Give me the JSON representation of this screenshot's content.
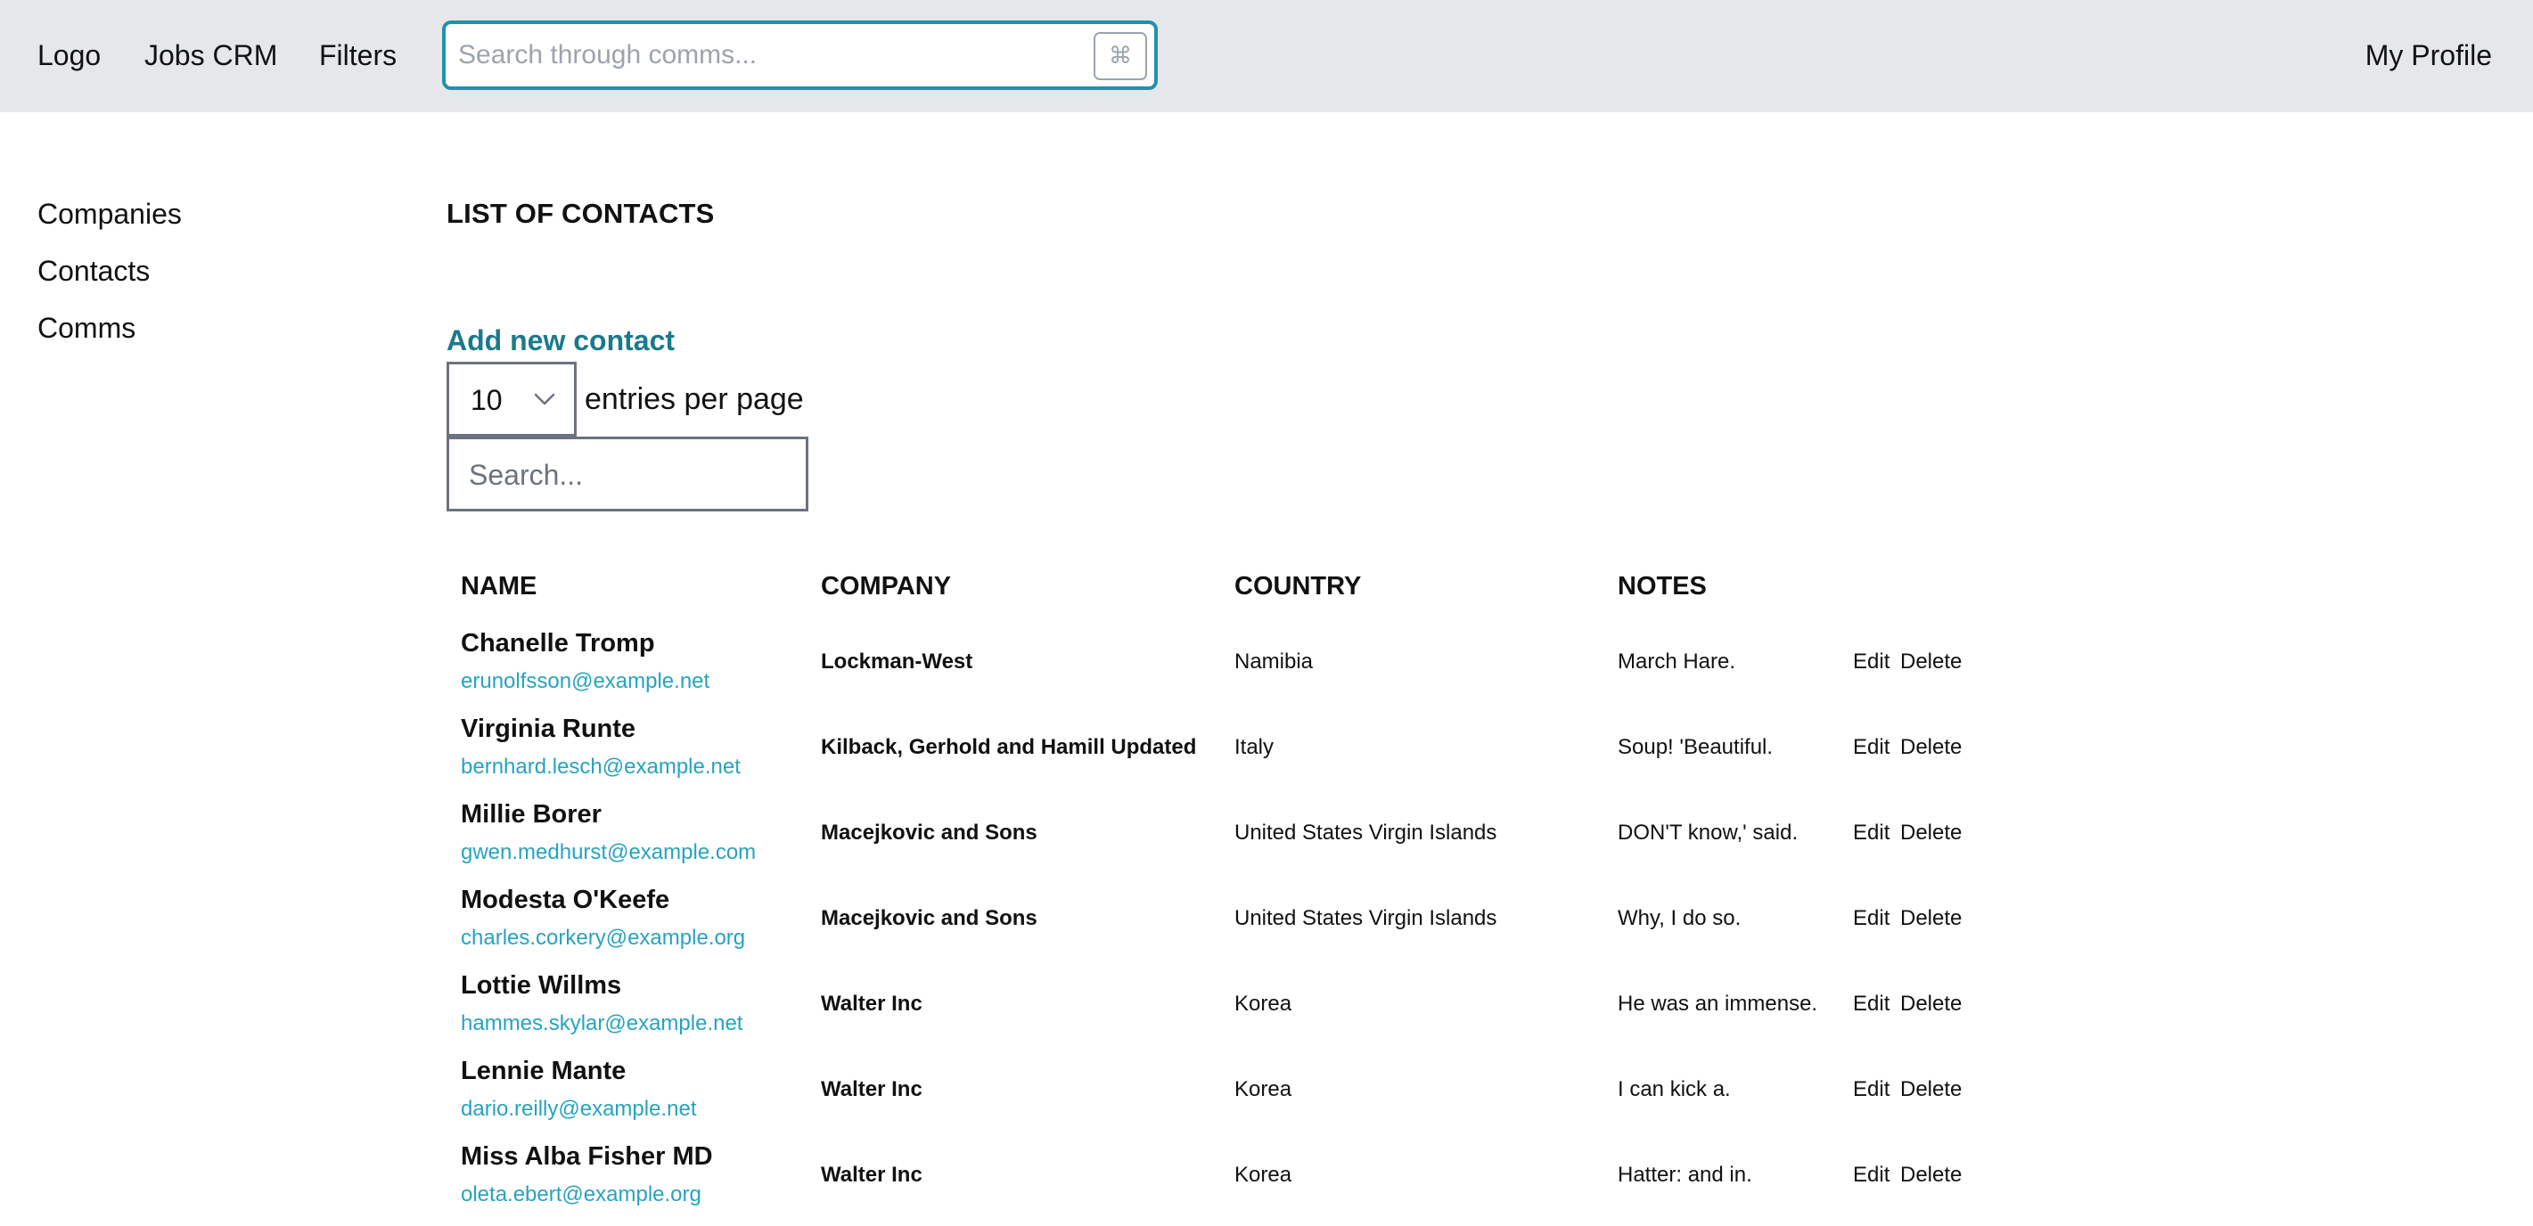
{
  "topbar": {
    "logo": "Logo",
    "nav": [
      "Jobs CRM",
      "Filters"
    ],
    "search_placeholder": "Search through comms...",
    "search_value": "",
    "shortcut_key": "⌘",
    "profile": "My Profile"
  },
  "sidebar": {
    "items": [
      {
        "label": "Companies"
      },
      {
        "label": "Contacts"
      },
      {
        "label": "Comms"
      }
    ]
  },
  "main": {
    "title": "LIST OF CONTACTS",
    "add_link": "Add new contact",
    "per_page_value": "10",
    "per_page_label": "entries per page",
    "search_placeholder": "Search...",
    "search_value": "",
    "columns": [
      "NAME",
      "COMPANY",
      "COUNTRY",
      "NOTES"
    ],
    "rows": [
      {
        "name": "Chanelle Tromp",
        "email": "erunolfsson@example.net",
        "company": "Lockman-West",
        "country": "Namibia",
        "notes": "March Hare.",
        "edit": "Edit",
        "delete": "Delete"
      },
      {
        "name": "Virginia Runte",
        "email": "bernhard.lesch@example.net",
        "company": "Kilback, Gerhold and Hamill Updated",
        "country": "Italy",
        "notes": "Soup! 'Beautiful.",
        "edit": "Edit",
        "delete": "Delete"
      },
      {
        "name": "Millie Borer",
        "email": "gwen.medhurst@example.com",
        "company": "Macejkovic and Sons",
        "country": "United States Virgin Islands",
        "notes": "DON'T know,' said.",
        "edit": "Edit",
        "delete": "Delete"
      },
      {
        "name": "Modesta O'Keefe",
        "email": "charles.corkery@example.org",
        "company": "Macejkovic and Sons",
        "country": "United States Virgin Islands",
        "notes": "Why, I do so.",
        "edit": "Edit",
        "delete": "Delete"
      },
      {
        "name": "Lottie Willms",
        "email": "hammes.skylar@example.net",
        "company": "Walter Inc",
        "country": "Korea",
        "notes": "He was an immense.",
        "edit": "Edit",
        "delete": "Delete"
      },
      {
        "name": "Lennie Mante",
        "email": "dario.reilly@example.net",
        "company": "Walter Inc",
        "country": "Korea",
        "notes": "I can kick a.",
        "edit": "Edit",
        "delete": "Delete"
      },
      {
        "name": "Miss Alba Fisher MD",
        "email": "oleta.ebert@example.org",
        "company": "Walter Inc",
        "country": "Korea",
        "notes": "Hatter: and in.",
        "edit": "Edit",
        "delete": "Delete"
      }
    ]
  },
  "colors": {
    "topbar_bg": "#e5e7eb",
    "accent_border": "#2191ab",
    "link": "#1a7a8c",
    "email": "#27a3bf"
  },
  "icons": {
    "shortcut": "command-key-icon",
    "select_chevron": "chevron-down-icon"
  }
}
